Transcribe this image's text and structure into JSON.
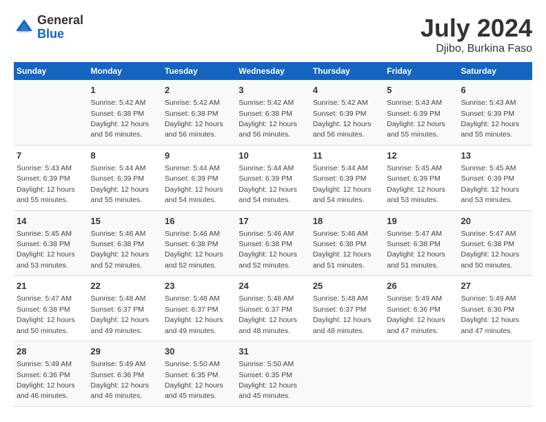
{
  "header": {
    "logo_general": "General",
    "logo_blue": "Blue",
    "month_title": "July 2024",
    "location": "Djibo, Burkina Faso"
  },
  "days_of_week": [
    "Sunday",
    "Monday",
    "Tuesday",
    "Wednesday",
    "Thursday",
    "Friday",
    "Saturday"
  ],
  "weeks": [
    [
      {
        "day": "",
        "sunrise": "",
        "sunset": "",
        "daylight": ""
      },
      {
        "day": "1",
        "sunrise": "Sunrise: 5:42 AM",
        "sunset": "Sunset: 6:38 PM",
        "daylight": "Daylight: 12 hours and 56 minutes."
      },
      {
        "day": "2",
        "sunrise": "Sunrise: 5:42 AM",
        "sunset": "Sunset: 6:38 PM",
        "daylight": "Daylight: 12 hours and 56 minutes."
      },
      {
        "day": "3",
        "sunrise": "Sunrise: 5:42 AM",
        "sunset": "Sunset: 6:38 PM",
        "daylight": "Daylight: 12 hours and 56 minutes."
      },
      {
        "day": "4",
        "sunrise": "Sunrise: 5:42 AM",
        "sunset": "Sunset: 6:39 PM",
        "daylight": "Daylight: 12 hours and 56 minutes."
      },
      {
        "day": "5",
        "sunrise": "Sunrise: 5:43 AM",
        "sunset": "Sunset: 6:39 PM",
        "daylight": "Daylight: 12 hours and 55 minutes."
      },
      {
        "day": "6",
        "sunrise": "Sunrise: 5:43 AM",
        "sunset": "Sunset: 6:39 PM",
        "daylight": "Daylight: 12 hours and 55 minutes."
      }
    ],
    [
      {
        "day": "7",
        "sunrise": "Sunrise: 5:43 AM",
        "sunset": "Sunset: 6:39 PM",
        "daylight": "Daylight: 12 hours and 55 minutes."
      },
      {
        "day": "8",
        "sunrise": "Sunrise: 5:44 AM",
        "sunset": "Sunset: 6:39 PM",
        "daylight": "Daylight: 12 hours and 55 minutes."
      },
      {
        "day": "9",
        "sunrise": "Sunrise: 5:44 AM",
        "sunset": "Sunset: 6:39 PM",
        "daylight": "Daylight: 12 hours and 54 minutes."
      },
      {
        "day": "10",
        "sunrise": "Sunrise: 5:44 AM",
        "sunset": "Sunset: 6:39 PM",
        "daylight": "Daylight: 12 hours and 54 minutes."
      },
      {
        "day": "11",
        "sunrise": "Sunrise: 5:44 AM",
        "sunset": "Sunset: 6:39 PM",
        "daylight": "Daylight: 12 hours and 54 minutes."
      },
      {
        "day": "12",
        "sunrise": "Sunrise: 5:45 AM",
        "sunset": "Sunset: 6:39 PM",
        "daylight": "Daylight: 12 hours and 53 minutes."
      },
      {
        "day": "13",
        "sunrise": "Sunrise: 5:45 AM",
        "sunset": "Sunset: 6:39 PM",
        "daylight": "Daylight: 12 hours and 53 minutes."
      }
    ],
    [
      {
        "day": "14",
        "sunrise": "Sunrise: 5:45 AM",
        "sunset": "Sunset: 6:38 PM",
        "daylight": "Daylight: 12 hours and 53 minutes."
      },
      {
        "day": "15",
        "sunrise": "Sunrise: 5:46 AM",
        "sunset": "Sunset: 6:38 PM",
        "daylight": "Daylight: 12 hours and 52 minutes."
      },
      {
        "day": "16",
        "sunrise": "Sunrise: 5:46 AM",
        "sunset": "Sunset: 6:38 PM",
        "daylight": "Daylight: 12 hours and 52 minutes."
      },
      {
        "day": "17",
        "sunrise": "Sunrise: 5:46 AM",
        "sunset": "Sunset: 6:38 PM",
        "daylight": "Daylight: 12 hours and 52 minutes."
      },
      {
        "day": "18",
        "sunrise": "Sunrise: 5:46 AM",
        "sunset": "Sunset: 6:38 PM",
        "daylight": "Daylight: 12 hours and 51 minutes."
      },
      {
        "day": "19",
        "sunrise": "Sunrise: 5:47 AM",
        "sunset": "Sunset: 6:38 PM",
        "daylight": "Daylight: 12 hours and 51 minutes."
      },
      {
        "day": "20",
        "sunrise": "Sunrise: 5:47 AM",
        "sunset": "Sunset: 6:38 PM",
        "daylight": "Daylight: 12 hours and 50 minutes."
      }
    ],
    [
      {
        "day": "21",
        "sunrise": "Sunrise: 5:47 AM",
        "sunset": "Sunset: 6:38 PM",
        "daylight": "Daylight: 12 hours and 50 minutes."
      },
      {
        "day": "22",
        "sunrise": "Sunrise: 5:48 AM",
        "sunset": "Sunset: 6:37 PM",
        "daylight": "Daylight: 12 hours and 49 minutes."
      },
      {
        "day": "23",
        "sunrise": "Sunrise: 5:48 AM",
        "sunset": "Sunset: 6:37 PM",
        "daylight": "Daylight: 12 hours and 49 minutes."
      },
      {
        "day": "24",
        "sunrise": "Sunrise: 5:48 AM",
        "sunset": "Sunset: 6:37 PM",
        "daylight": "Daylight: 12 hours and 48 minutes."
      },
      {
        "day": "25",
        "sunrise": "Sunrise: 5:48 AM",
        "sunset": "Sunset: 6:37 PM",
        "daylight": "Daylight: 12 hours and 48 minutes."
      },
      {
        "day": "26",
        "sunrise": "Sunrise: 5:49 AM",
        "sunset": "Sunset: 6:36 PM",
        "daylight": "Daylight: 12 hours and 47 minutes."
      },
      {
        "day": "27",
        "sunrise": "Sunrise: 5:49 AM",
        "sunset": "Sunset: 6:36 PM",
        "daylight": "Daylight: 12 hours and 47 minutes."
      }
    ],
    [
      {
        "day": "28",
        "sunrise": "Sunrise: 5:49 AM",
        "sunset": "Sunset: 6:36 PM",
        "daylight": "Daylight: 12 hours and 46 minutes."
      },
      {
        "day": "29",
        "sunrise": "Sunrise: 5:49 AM",
        "sunset": "Sunset: 6:36 PM",
        "daylight": "Daylight: 12 hours and 46 minutes."
      },
      {
        "day": "30",
        "sunrise": "Sunrise: 5:50 AM",
        "sunset": "Sunset: 6:35 PM",
        "daylight": "Daylight: 12 hours and 45 minutes."
      },
      {
        "day": "31",
        "sunrise": "Sunrise: 5:50 AM",
        "sunset": "Sunset: 6:35 PM",
        "daylight": "Daylight: 12 hours and 45 minutes."
      },
      {
        "day": "",
        "sunrise": "",
        "sunset": "",
        "daylight": ""
      },
      {
        "day": "",
        "sunrise": "",
        "sunset": "",
        "daylight": ""
      },
      {
        "day": "",
        "sunrise": "",
        "sunset": "",
        "daylight": ""
      }
    ]
  ]
}
